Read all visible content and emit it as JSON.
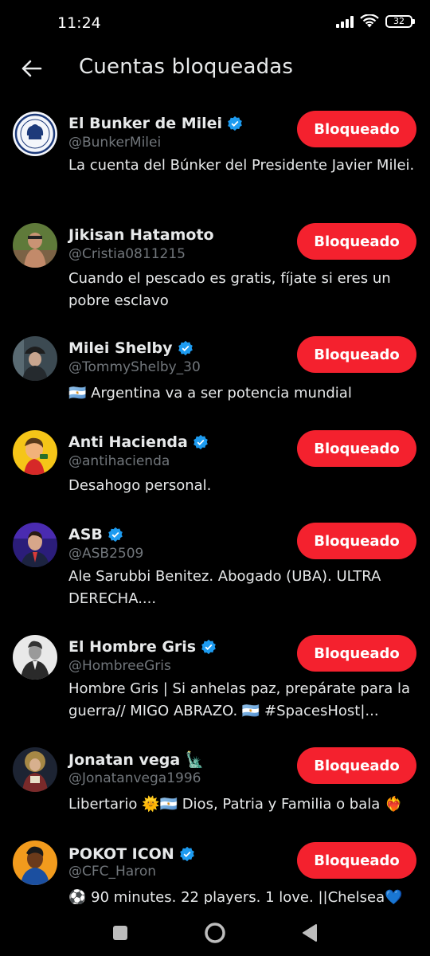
{
  "status_bar": {
    "time": "11:24",
    "battery": "32",
    "icons": [
      "signal-icon",
      "wifi-icon",
      "battery-icon"
    ]
  },
  "header": {
    "title": "Cuentas bloqueadas",
    "back_icon": "arrow-left-icon"
  },
  "colors": {
    "background": "#000000",
    "accent_red": "#f4212e",
    "verified_blue": "#1d9bf0",
    "handle_gray": "#71767b",
    "text": "#e7e9ea"
  },
  "accounts": [
    {
      "name": "El Bunker de Milei",
      "verified": true,
      "handle": "@BunkerMilei",
      "bio": "La cuenta del Búnker del Presidente Javier Milei.",
      "button": "Bloqueado"
    },
    {
      "name": "Jikisan Hatamoto",
      "verified": false,
      "handle": "@Cristia0811215",
      "bio": "Cuando el pescado es gratis, fíjate si eres un pobre esclavo",
      "button": "Bloqueado"
    },
    {
      "name": "Milei Shelby",
      "verified": true,
      "handle": "@TommyShelby_30",
      "bio": "🇦🇷 Argentina va a ser potencia mundial",
      "button": "Bloqueado"
    },
    {
      "name": "Anti Hacienda",
      "verified": true,
      "handle": "@antihacienda",
      "bio": "Desahogo personal.",
      "button": "Bloqueado"
    },
    {
      "name": "ASB",
      "verified": true,
      "handle": "@ASB2509",
      "bio": "Ale Sarubbi Benitez. Abogado (UBA). ULTRA DERECHA....",
      "button": "Bloqueado"
    },
    {
      "name": "El Hombre Gris",
      "verified": true,
      "handle": "@HombreeGris",
      "bio": "Hombre Gris | Si anhelas paz, prepárate para la guerra// MIGO ABRAZO. 🇦🇷 #SpacesHost|...",
      "button": "Bloqueado"
    },
    {
      "name": "Jonatan vega 🗽",
      "verified": false,
      "handle": "@Jonatanvega1996",
      "bio": "Libertario 🌞🇦🇷 Dios, Patria y Familia o bala ❤️‍🔥",
      "button": "Bloqueado"
    },
    {
      "name": "POKOT ICON",
      "verified": true,
      "handle": "@CFC_Haron",
      "bio": "⚽ 90 minutes. 22 players. 1 love. ||Chelsea💙",
      "button": "Bloqueado"
    }
  ],
  "nav_bar": {
    "buttons": [
      "recents-square-icon",
      "home-circle-icon",
      "back-triangle-icon"
    ]
  }
}
